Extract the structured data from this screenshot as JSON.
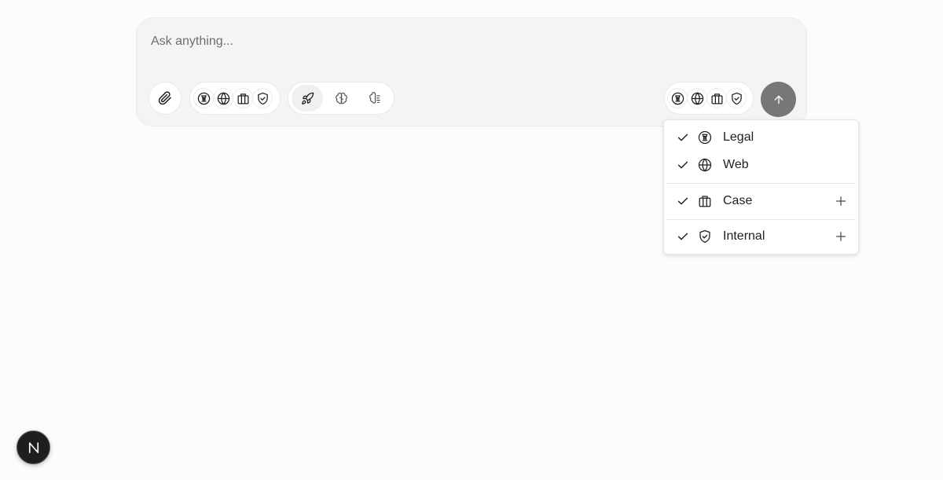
{
  "composer": {
    "placeholder": "Ask anything...",
    "value": ""
  },
  "toolbar": {
    "attach_icon": "paperclip-icon",
    "left_sources": [
      {
        "name": "legal",
        "icon": "scales-icon"
      },
      {
        "name": "web",
        "icon": "globe-icon"
      },
      {
        "name": "case",
        "icon": "briefcase-icon"
      },
      {
        "name": "internal",
        "icon": "shield-icon"
      }
    ],
    "modes": [
      {
        "name": "fast",
        "icon": "rocket-icon",
        "active": true
      },
      {
        "name": "think",
        "icon": "brain-icon",
        "active": false
      },
      {
        "name": "deep",
        "icon": "research-icon",
        "active": false
      }
    ],
    "right_sources": [
      {
        "name": "legal",
        "icon": "scales-icon"
      },
      {
        "name": "web",
        "icon": "globe-icon"
      },
      {
        "name": "case",
        "icon": "briefcase-icon"
      },
      {
        "name": "internal",
        "icon": "shield-icon"
      }
    ],
    "send_icon": "arrow-up-icon"
  },
  "sources_menu": {
    "items": [
      {
        "label": "Legal",
        "icon": "scales-icon",
        "checked": true,
        "addable": false
      },
      {
        "label": "Web",
        "icon": "globe-icon",
        "checked": true,
        "addable": false
      },
      {
        "label": "Case",
        "icon": "briefcase-icon",
        "checked": true,
        "addable": true
      },
      {
        "label": "Internal",
        "icon": "shield-icon",
        "checked": true,
        "addable": true
      }
    ]
  },
  "colors": {
    "page_bg": "#fcfcfc",
    "composer_bg": "#f4f4f4",
    "send_button": "#777777",
    "badge_bg": "#1e1e1e"
  },
  "badge": {
    "text": "N"
  }
}
